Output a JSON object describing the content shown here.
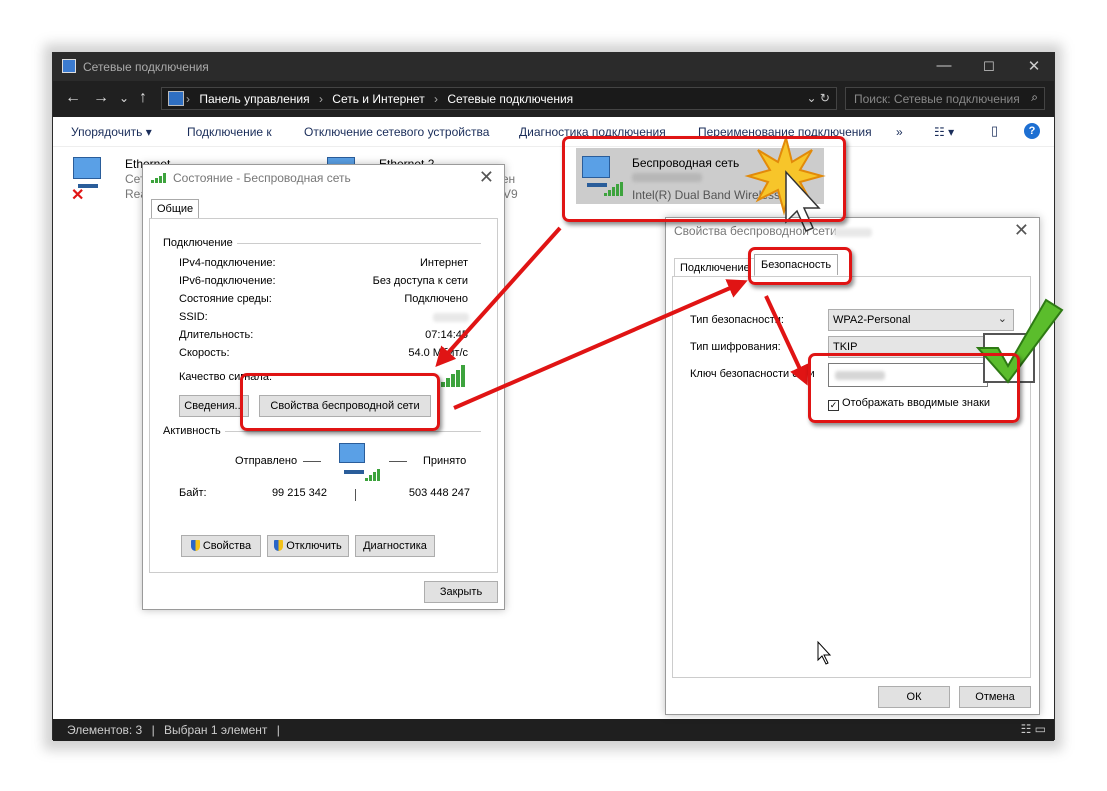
{
  "window": {
    "title": "Сетевые подключения",
    "min": "—",
    "max": "☐",
    "close": "✕"
  },
  "nav": {
    "back": "←",
    "forward": "→",
    "dropdown": "⌄",
    "up": "↑",
    "crumbs": [
      "Панель управления",
      "Сеть и Интернет",
      "Сетевые подключения"
    ],
    "crumb_sep": "›",
    "addr_tools": "⌄ ↻",
    "search_placeholder": "Поиск: Сетевые подключения",
    "search_icon": "⌕"
  },
  "toolbar": {
    "organize": "Упорядочить ▾",
    "connect": "Подключение к",
    "disable": "Отключение сетевого устройства",
    "diagnose": "Диагностика подключения",
    "rename": "Переименование подключения",
    "more": "»",
    "view": "☷ ▾",
    "pane": "▯",
    "help": "?"
  },
  "adapters": [
    {
      "name": "Ethernet",
      "line1": "Сет",
      "line2": "Rea"
    },
    {
      "name": "Ethernet 2",
      "line1": "нчен",
      "line2": "V9"
    },
    {
      "name": "Беспроводная сеть",
      "line2": "Intel(R) Dual Band Wireless-A..."
    }
  ],
  "status_bar": {
    "items": "Элементов: 3",
    "sep": "|",
    "selected": "Выбран 1 элемент",
    "sep2": "|",
    "right": "☷ ▭"
  },
  "status_dialog": {
    "title": "Состояние - Беспроводная сеть",
    "close": "✕",
    "tab": "Общие",
    "connection_group": "Подключение",
    "rows": [
      {
        "label": "IPv4-подключение:",
        "value": "Интернет"
      },
      {
        "label": "IPv6-подключение:",
        "value": "Без доступа к сети"
      },
      {
        "label": "Состояние среды:",
        "value": "Подключено"
      },
      {
        "label": "SSID:",
        "value": ""
      },
      {
        "label": "Длительность:",
        "value": "07:14:45"
      },
      {
        "label": "Скорость:",
        "value": "54.0 Мбит/с"
      }
    ],
    "signal_label": "Качество сигнала:",
    "signal_bars": 5,
    "details_button": "Сведения...",
    "wireless_props_button": "Свойства беспроводной сети",
    "activity_group": "Активность",
    "sent_label": "Отправлено",
    "received_label": "Принято",
    "bytes_label": "Байт:",
    "bytes_sent": "99 215 342",
    "bytes_received": "503 448 247",
    "properties_button": "Свойства",
    "disable_button": "Отключить",
    "diagnose_button": "Диагностика",
    "close_button": "Закрыть"
  },
  "props_dialog": {
    "title": "Свойства беспроводной сети",
    "close": "✕",
    "tab_connection": "Подключение",
    "tab_security": "Безопасность",
    "security_type_label": "Тип безопасности:",
    "security_type_value": "WPA2-Personal",
    "encryption_label": "Тип шифрования:",
    "encryption_value": "TKIP",
    "key_label": "Ключ безопасности сети",
    "show_chars_label": "Отображать вводимые знаки",
    "show_chars_checked": "✓",
    "ok_button": "ОК",
    "cancel_button": "Отмена",
    "select_arrow": "⌄"
  },
  "colors": {
    "highlight": "#e01414",
    "accent": "#1d6fd2",
    "signal": "#3da33d"
  }
}
